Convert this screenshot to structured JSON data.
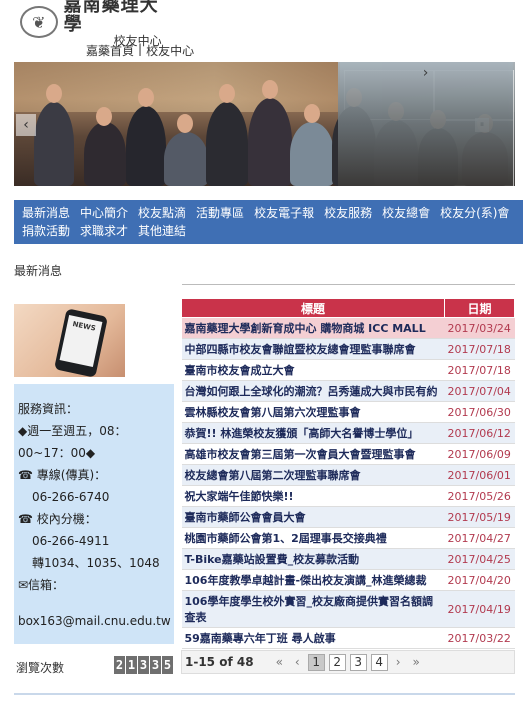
{
  "brand": {
    "emblem": "❦",
    "name": "嘉南藥理大學",
    "sub": "校友中心"
  },
  "breadcrumb": [
    "嘉藥首頁",
    "|",
    "校友中心"
  ],
  "banner": {
    "prev_arrow": "‹",
    "next_arrow": "›",
    "pause_icon": "⏸"
  },
  "nav": {
    "items": [
      "最新消息",
      "中心簡介",
      "校友點滴",
      "活動專區",
      "校友電子報",
      "校友服務",
      "校友總會",
      "校友分(系)會",
      "捐款活動",
      "求職求才",
      "其他連結"
    ]
  },
  "section_title": "最新消息",
  "phone_screen_text": "NEWS",
  "service": {
    "heading": "服務資訊：",
    "hours_line1": "◆週一至週五，08：",
    "hours_line2": "00~17：00◆",
    "phone_label": "☎ 專線(傳真)：",
    "phone_value": "06-266-6740",
    "ext_label": "☎ 校內分機：",
    "ext_value": "06-266-4911",
    "ext_numbers": "轉1034、1035、1048",
    "mail_label": "✉信箱：",
    "mail_value": "box163@mail.cnu.edu.tw"
  },
  "visits": {
    "label": "瀏覽次數",
    "digits": [
      "2",
      "1",
      "3",
      "3",
      "5"
    ]
  },
  "news": {
    "header_title": "標題",
    "header_date": "日期",
    "rows": [
      {
        "title": "嘉南藥理大學創新育成中心 購物商城 ICC MALL",
        "date": "2017/03/24"
      },
      {
        "title": "中部四縣市校友會聯誼暨校友總會理監事聯席會",
        "date": "2017/07/18"
      },
      {
        "title": "臺南市校友會成立大會",
        "date": "2017/07/18"
      },
      {
        "title": "台灣如何跟上全球化的潮流？呂秀蓮成大與市民有約",
        "date": "2017/07/04"
      },
      {
        "title": "雲林縣校友會第八屆第六次理監事會",
        "date": "2017/06/30"
      },
      {
        "title": "恭賀!! 林進榮校友獲頒「高師大名譽博士學位」",
        "date": "2017/06/12"
      },
      {
        "title": "高雄市校友會第三屆第一次會員大會暨理監事會",
        "date": "2017/06/09"
      },
      {
        "title": "校友總會第八屆第二次理監事聯席會",
        "date": "2017/06/01"
      },
      {
        "title": "祝大家端午佳節快樂!!",
        "date": "2017/05/26"
      },
      {
        "title": "臺南市藥師公會會員大會",
        "date": "2017/05/19"
      },
      {
        "title": "桃園市藥師公會第1、2屆理事長交接典禮",
        "date": "2017/04/27"
      },
      {
        "title": "T-Bike嘉藥站設置費_校友募款活動",
        "date": "2017/04/25"
      },
      {
        "title": "106年度教學卓越計畫-傑出校友演講_林進榮總裁",
        "date": "2017/04/20"
      },
      {
        "title": "106學年度學生校外實習_校友廠商提供實習名額調查表",
        "date": "2017/04/19"
      },
      {
        "title": "59嘉南藥專六年丁班 尋人啟事",
        "date": "2017/03/22"
      }
    ]
  },
  "pager": {
    "info": "1-15 of 48",
    "first": "«",
    "prev": "‹",
    "pages": [
      "1",
      "2",
      "3",
      "4"
    ],
    "current": "1",
    "next": "›",
    "last": "»"
  }
}
